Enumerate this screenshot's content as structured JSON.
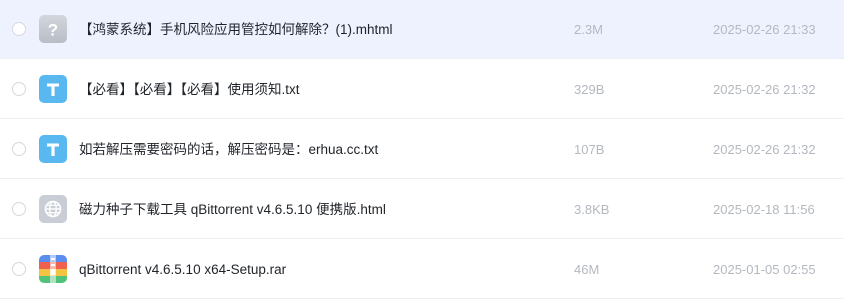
{
  "files": [
    {
      "name": "【鸿蒙系统】手机风险应用管控如何解除？(1).mhtml",
      "size": "2.3M",
      "date": "2025-02-26 21:33",
      "icon": "unknown-file-icon"
    },
    {
      "name": "【必看】【必看】【必看】使用须知.txt",
      "size": "329B",
      "date": "2025-02-26 21:32",
      "icon": "text-file-icon"
    },
    {
      "name": "如若解压需要密码的话，解压密码是：erhua.cc.txt",
      "size": "107B",
      "date": "2025-02-26 21:32",
      "icon": "text-file-icon"
    },
    {
      "name": "磁力种子下载工具 qBittorrent v4.6.5.10 便携版.html",
      "size": "3.8KB",
      "date": "2025-02-18 11:56",
      "icon": "web-file-icon"
    },
    {
      "name": "qBittorrent v4.6.5.10 x64-Setup.rar",
      "size": "46M",
      "date": "2025-01-05 02:55",
      "icon": "archive-file-icon"
    }
  ],
  "colors": {
    "selected_row": "#eef2ff",
    "text_icon": "#5ab8f0",
    "unknown_icon": "#c8ccd3",
    "web_icon": "#c9cdd6"
  }
}
